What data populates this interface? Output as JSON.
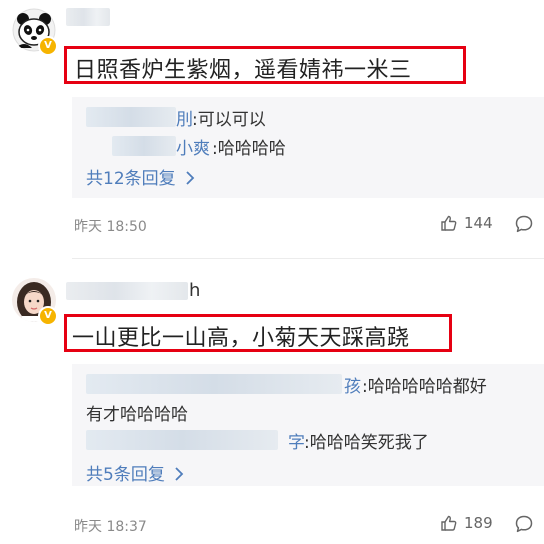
{
  "comments": [
    {
      "verified_badge": "V",
      "text": "日照香炉生紫烟，遥看婧祎一米三",
      "replies": [
        {
          "name": "刖",
          "text": ":可以可以"
        },
        {
          "name": "小爽",
          "text": ":哈哈哈哈"
        }
      ],
      "more_replies": "共12条回复",
      "time": "昨天 18:50",
      "likes": "144",
      "icons": {
        "like": "thumbs-up-icon",
        "reply": "comment-bubble-icon"
      }
    },
    {
      "username_tail": "h",
      "verified_badge": "V",
      "text": "一山更比一山高，小菊天天踩高跷",
      "replies": [
        {
          "name": "孩",
          "text": ":哈哈哈哈哈都好",
          "text_line2": "有才哈哈哈哈"
        },
        {
          "name": "字",
          "text": ":哈哈哈笑死我了"
        }
      ],
      "more_replies": "共5条回复",
      "time": "昨天 18:37",
      "likes": "189",
      "icons": {
        "like": "thumbs-up-icon",
        "reply": "comment-bubble-icon"
      }
    }
  ],
  "colors": {
    "highlight": "#e60012",
    "link": "#4f7dbb",
    "badge": "#f6b400"
  }
}
